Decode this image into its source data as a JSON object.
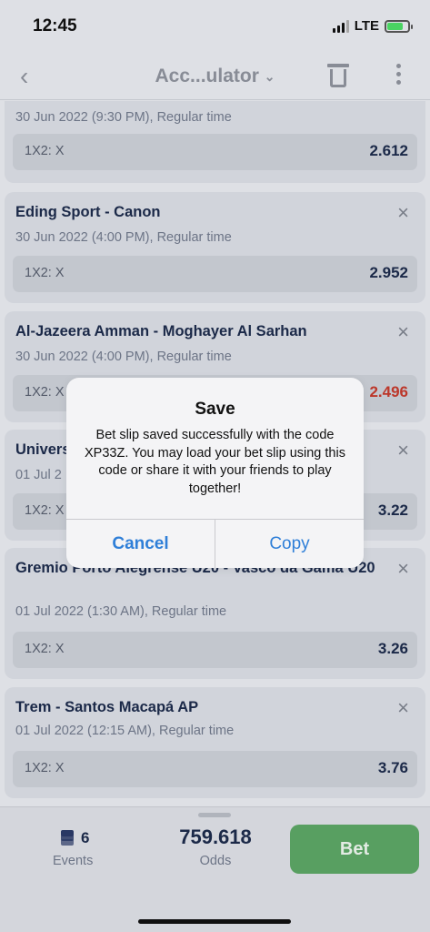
{
  "status_bar": {
    "time": "12:45",
    "network": "LTE"
  },
  "nav": {
    "title": "Acc...ulator",
    "back_glyph": "‹",
    "chevron_glyph": "⌄"
  },
  "bets": [
    {
      "title": "",
      "meta": "30 Jun 2022 (9:30 PM), Regular time",
      "pick": "1X2: X",
      "odds": "2.612"
    },
    {
      "title": "Eding Sport - Canon",
      "meta": "30 Jun 2022 (4:00 PM), Regular time",
      "pick": "1X2: X",
      "odds": "2.952"
    },
    {
      "title": "Al-Jazeera Amman - Moghayer Al Sarhan",
      "meta": "30 Jun 2022 (4:00 PM), Regular time",
      "pick": "1X2: X",
      "odds": "2.496"
    },
    {
      "title": "Univers",
      "meta": "01 Jul 2",
      "pick": "1X2: X",
      "odds": "3.22"
    },
    {
      "title": "Gremio Porto Alegrense U20 - Vasco da Gama U20",
      "meta": "01 Jul 2022 (1:30 AM), Regular time",
      "pick": "1X2: X",
      "odds": "3.26"
    },
    {
      "title": "Trem - Santos Macapá AP",
      "meta": "01 Jul 2022 (12:15 AM), Regular time",
      "pick": "1X2: X",
      "odds": "3.76"
    }
  ],
  "summary": {
    "events_count": "6",
    "events_label": "Events",
    "odds_total": "759.618",
    "odds_label": "Odds",
    "bet_label": "Bet"
  },
  "dialog": {
    "title": "Save",
    "message": "Bet slip saved successfully with the code XP33Z. You may load your bet slip using this code or share it with your friends to play together!",
    "cancel_label": "Cancel",
    "copy_label": "Copy"
  },
  "colors": {
    "accent": "#2f7fd8",
    "bet_button": "#5aa363",
    "odds_highlight": "#c0392b"
  },
  "icons": {
    "close": "×"
  }
}
